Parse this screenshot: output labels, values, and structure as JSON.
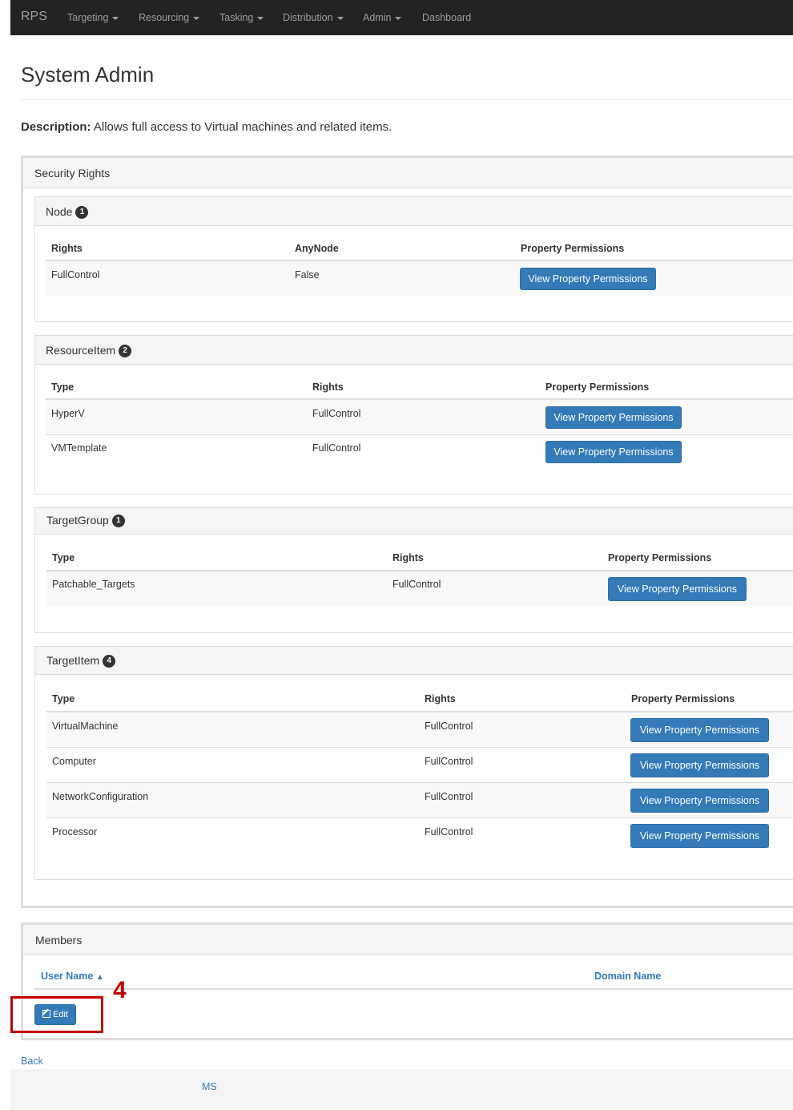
{
  "navbar": {
    "brand": "RPS",
    "items": [
      {
        "label": "Targeting",
        "dropdown": true
      },
      {
        "label": "Resourcing",
        "dropdown": true
      },
      {
        "label": "Tasking",
        "dropdown": true
      },
      {
        "label": "Distribution",
        "dropdown": true
      },
      {
        "label": "Admin",
        "dropdown": true
      },
      {
        "label": "Dashboard",
        "dropdown": false
      }
    ]
  },
  "page": {
    "title": "System Admin",
    "description_label": "Description:",
    "description_text": " Allows full access to Virtual machines and related items."
  },
  "security_rights": {
    "title": "Security Rights",
    "node": {
      "title": "Node",
      "count": "1",
      "headers": [
        "Rights",
        "AnyNode",
        "Property Permissions"
      ],
      "rows": [
        {
          "c1": "FullControl",
          "c2": "False",
          "button": "View Property Permissions"
        }
      ]
    },
    "resource_item": {
      "title": "ResourceItem",
      "count": "2",
      "headers": [
        "Type",
        "Rights",
        "Property Permissions"
      ],
      "rows": [
        {
          "c1": "HyperV",
          "c2": "FullControl",
          "button": "View Property Permissions"
        },
        {
          "c1": "VMTemplate",
          "c2": "FullControl",
          "button": "View Property Permissions"
        }
      ]
    },
    "target_group": {
      "title": "TargetGroup",
      "count": "1",
      "headers": [
        "Type",
        "Rights",
        "Property Permissions"
      ],
      "rows": [
        {
          "c1": "Patchable_Targets",
          "c2": "FullControl",
          "button": "View Property Permissions"
        }
      ]
    },
    "target_item": {
      "title": "TargetItem",
      "count": "4",
      "headers": [
        "Type",
        "Rights",
        "Property Permissions"
      ],
      "rows": [
        {
          "c1": "VirtualMachine",
          "c2": "FullControl",
          "button": "View Property Permissions"
        },
        {
          "c1": "Computer",
          "c2": "FullControl",
          "button": "View Property Permissions"
        },
        {
          "c1": "NetworkConfiguration",
          "c2": "FullControl",
          "button": "View Property Permissions"
        },
        {
          "c1": "Processor",
          "c2": "FullControl",
          "button": "View Property Permissions"
        }
      ]
    }
  },
  "members": {
    "title": "Members",
    "col_user_name": "User Name",
    "sort_indicator": "▲",
    "col_domain_name": "Domain Name",
    "edit_button": "Edit",
    "edit_icon": "edit-icon"
  },
  "annotation": {
    "number": "4",
    "color": "#c00000"
  },
  "back_link": "Back",
  "footer_text": "MS",
  "colors": {
    "navbar_bg": "#222222",
    "primary_button": "#337ab7",
    "link": "#337ab7"
  }
}
